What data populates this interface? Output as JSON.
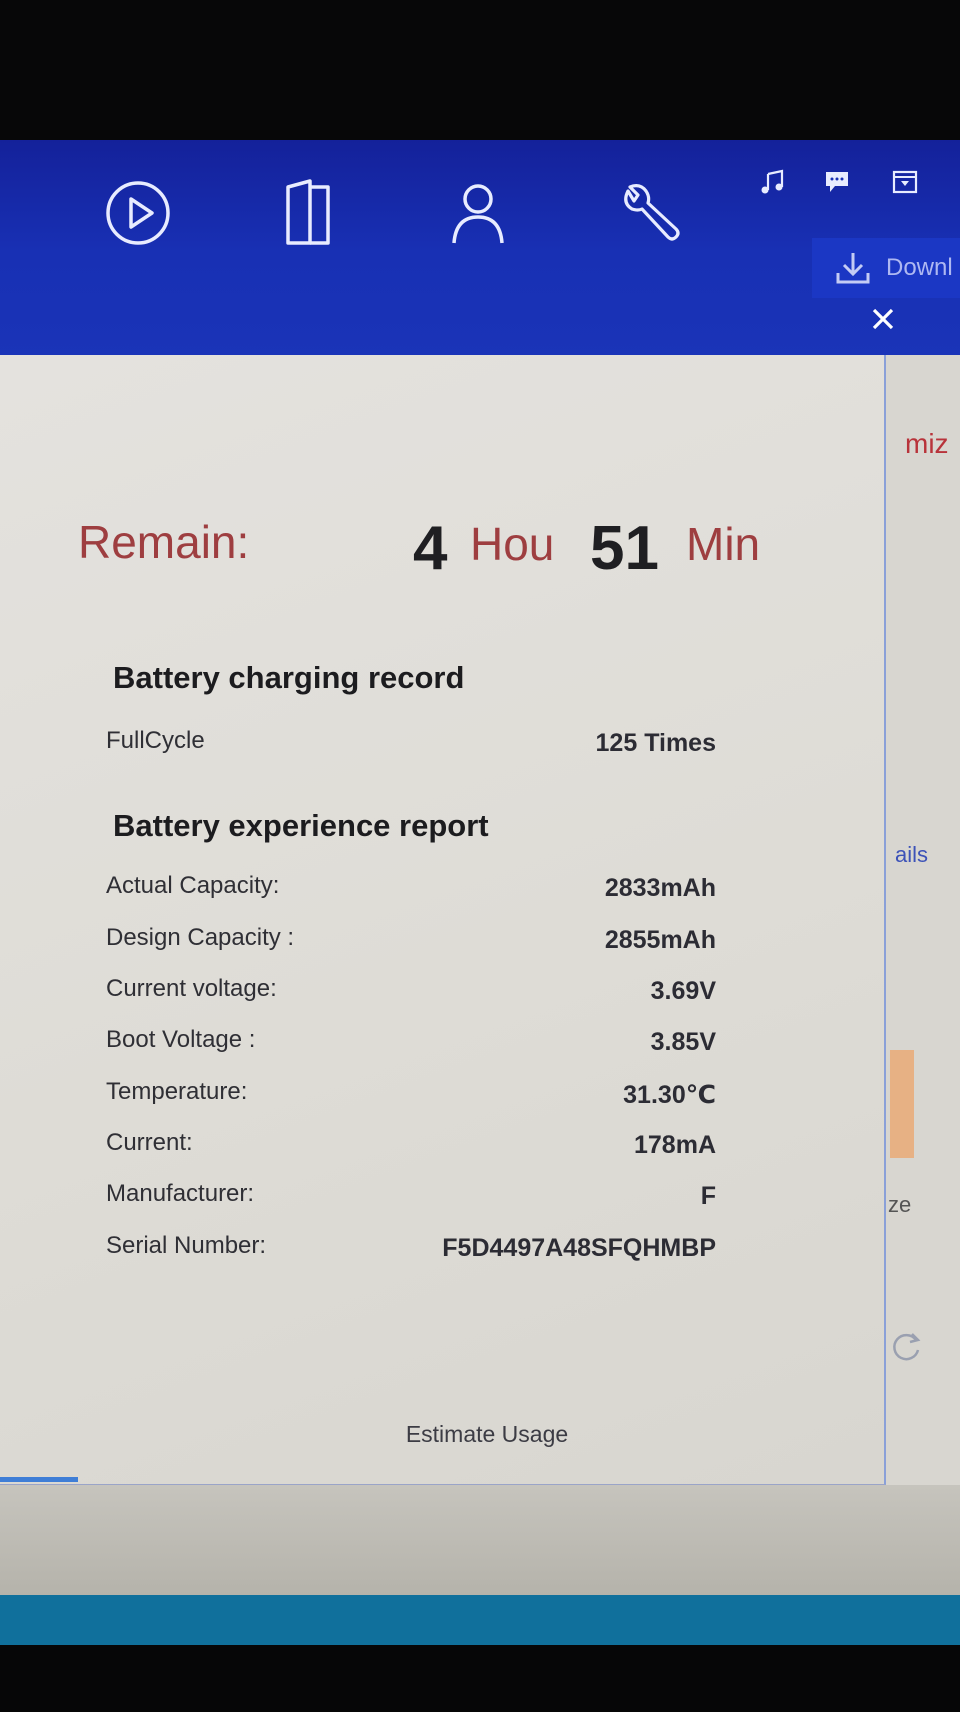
{
  "toolbar": {
    "nav_icons": [
      "play-icon",
      "book-icon",
      "user-icon",
      "wrench-icon"
    ],
    "mini_icons": [
      "music-icon",
      "chat-icon",
      "dropdown-icon"
    ],
    "download_label": "Downl"
  },
  "background": {
    "optimize_fragment": "miz",
    "details_fragment": "ails",
    "size_fragment": "ze"
  },
  "dialog": {
    "remain": {
      "label": "Remain:",
      "hours_value": "4",
      "hours_unit": "Hou",
      "minutes_value": "51",
      "minutes_unit": "Min"
    },
    "charging_record": {
      "title": "Battery charging record",
      "rows": [
        {
          "label": "FullCycle",
          "value": "125 Times"
        }
      ]
    },
    "experience_report": {
      "title": "Battery experience report",
      "rows": [
        {
          "label": "Actual Capacity:",
          "value": "2833mAh"
        },
        {
          "label": "Design  Capacity :",
          "value": "2855mAh"
        },
        {
          "label": "Current voltage:",
          "value": "3.69V"
        },
        {
          "label": "Boot  Voltage :",
          "value": "3.85V"
        },
        {
          "label": "Temperature:",
          "value": "31.30℃"
        },
        {
          "label": "Current:",
          "value": "178mA"
        },
        {
          "label": "Manufacturer:",
          "value": "F"
        },
        {
          "label": "Serial Number:",
          "value": "F5D4497A48SFQHMBP"
        }
      ]
    },
    "estimate_link": "Estimate Usage"
  },
  "colors": {
    "toolbar_blue": "#1830b4",
    "accent_red": "#9e3e40",
    "dialog_bg": "#e0ded9",
    "taskbar": "#10709c"
  }
}
